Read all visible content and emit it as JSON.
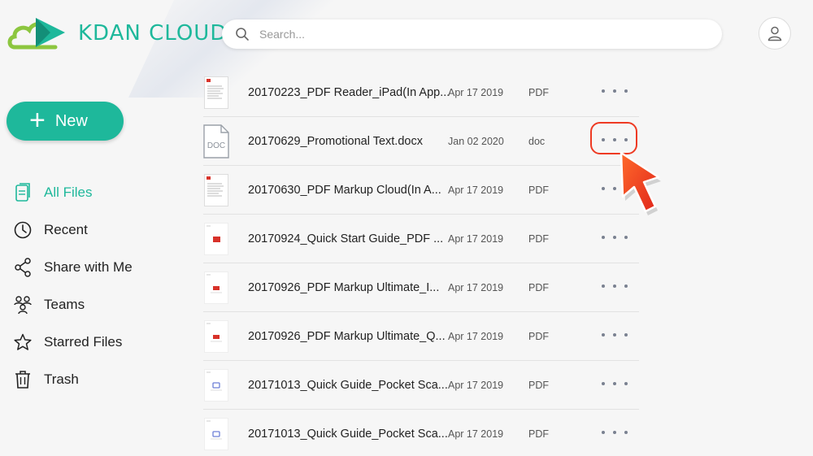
{
  "brand": {
    "name": "KDAN CLOUD"
  },
  "search": {
    "placeholder": "Search..."
  },
  "new_button": {
    "label": "New"
  },
  "sidebar": {
    "items": [
      {
        "label": "All Files",
        "icon": "file-icon",
        "active": true
      },
      {
        "label": "Recent",
        "icon": "clock-icon",
        "active": false
      },
      {
        "label": "Share with Me",
        "icon": "share-icon",
        "active": false
      },
      {
        "label": "Teams",
        "icon": "teams-icon",
        "active": false
      },
      {
        "label": "Starred Files",
        "icon": "star-icon",
        "active": false
      },
      {
        "label": "Trash",
        "icon": "trash-icon",
        "active": false
      }
    ]
  },
  "files": [
    {
      "name": "20170223_PDF Reader_iPad(In App...",
      "date": "Apr 17 2019",
      "type": "PDF",
      "thumb": "doc-red"
    },
    {
      "name": "20170629_Promotional Text.docx",
      "date": "Jan 02 2020",
      "type": "doc",
      "thumb": "docx",
      "thumb_label": "DOC"
    },
    {
      "name": "20170630_PDF Markup Cloud(In A...",
      "date": "Apr 17 2019",
      "type": "PDF",
      "thumb": "doc-red"
    },
    {
      "name": "20170924_Quick Start Guide_PDF ...",
      "date": "Apr 17 2019",
      "type": "PDF",
      "thumb": "red-square"
    },
    {
      "name": "20170926_PDF Markup Ultimate_I...",
      "date": "Apr 17 2019",
      "type": "PDF",
      "thumb": "red-small"
    },
    {
      "name": "20170926_PDF Markup Ultimate_Q...",
      "date": "Apr 17 2019",
      "type": "PDF",
      "thumb": "red-small"
    },
    {
      "name": "20171013_Quick Guide_Pocket Sca...",
      "date": "Apr 17 2019",
      "type": "PDF",
      "thumb": "blue-small"
    },
    {
      "name": "20171013_Quick Guide_Pocket Sca...",
      "date": "Apr 17 2019",
      "type": "PDF",
      "thumb": "blue-small"
    }
  ],
  "colors": {
    "accent": "#1eb89b",
    "highlight": "#ee3a23"
  }
}
